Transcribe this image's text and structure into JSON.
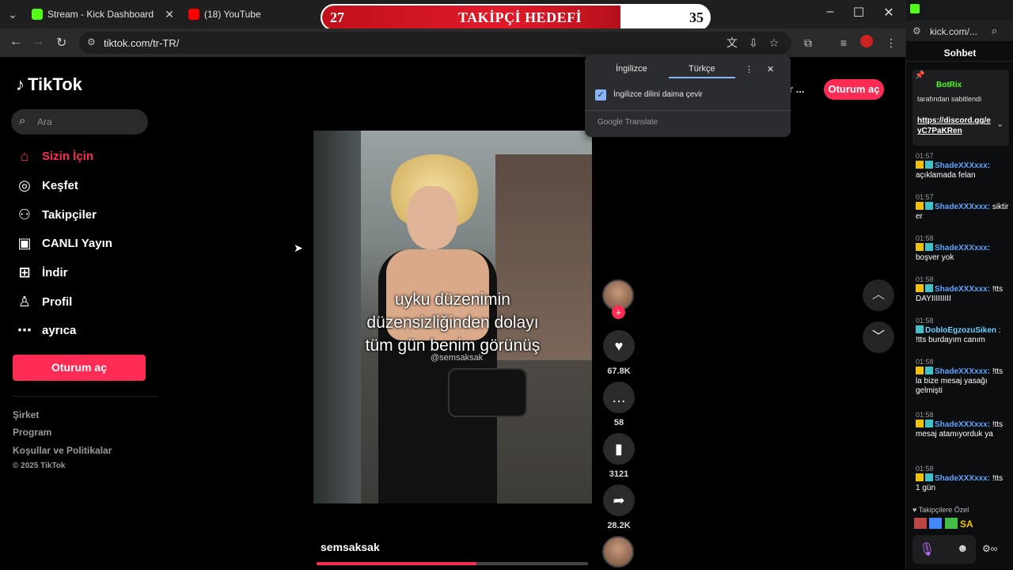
{
  "browser": {
    "tabs": [
      {
        "label": "Stream - Kick Dashboard",
        "color": "#53fc18"
      },
      {
        "label": "(18) YouTube",
        "color": "#ff0000"
      }
    ],
    "url": "tiktok.com/tr-TR/"
  },
  "overlay": {
    "label": "TAKİPÇİ HEDEFİ",
    "current": "27",
    "target": "35",
    "progress": 0.77
  },
  "translate_popup": {
    "lang_source": "İngilizce",
    "lang_target": "Türkçe",
    "option": "İngilizce dilini daima çevir",
    "footer": "Google Translate"
  },
  "tiktok": {
    "logo": "TikTok",
    "search_placeholder": "Ara",
    "nav": [
      {
        "label": "Sizin İçin",
        "icon": "home-icon"
      },
      {
        "label": "Keşfet",
        "icon": "compass-icon"
      },
      {
        "label": "Takipçiler",
        "icon": "followers-icon"
      },
      {
        "label": "CANLI Yayın",
        "icon": "live-icon"
      },
      {
        "label": "İndir",
        "icon": "download-icon"
      },
      {
        "label": "Profil",
        "icon": "profile-icon"
      },
      {
        "label": "ayrıca",
        "icon": "more-icon"
      }
    ],
    "login_label": "Oturum aç",
    "top_partial": "r ...",
    "footer": [
      "Şirket",
      "Program",
      "Koşullar ve Politikalar",
      "© 2025 TikTok"
    ],
    "video": {
      "caption": [
        "uyku düzenimin",
        "düzensizliğinden dolayı",
        "tüm gün benim görünüş"
      ],
      "watermark": "@semsaksak",
      "author": "semsaksak",
      "progress": 0.59
    },
    "actions": [
      {
        "icon": "heart-icon",
        "count": "67.8K"
      },
      {
        "icon": "comment-icon",
        "count": "58"
      },
      {
        "icon": "bookmark-icon",
        "count": "3121"
      },
      {
        "icon": "share-icon",
        "count": "28.2K"
      }
    ]
  },
  "chat": {
    "url": "kick.com/...",
    "title": "Sohbet",
    "pinned": {
      "user": "BotRix",
      "by": "tarafından sabitlendi",
      "link": "https://discord.gg/eyC7PaKRen"
    },
    "messages": [
      {
        "time": "01:57",
        "user": "ShadeXXXxxx:",
        "text": "açıklamada felan"
      },
      {
        "time": "01:57",
        "user": "ShadeXXXxxx:",
        "text": "siktir er"
      },
      {
        "time": "01:58",
        "user": "ShadeXXXxxx:",
        "text": "boşver yok"
      },
      {
        "time": "01:58",
        "user": "ShadeXXXxxx:",
        "text": "!tts DAYIIIIIIIII"
      },
      {
        "time": "01:58",
        "user": "DobloEgzozuSiken",
        "text": ": !tts burdayım canım"
      },
      {
        "time": "01:58",
        "user": "ShadeXXXxxx:",
        "text": "!tts la bize mesaj yasağı gelmişti"
      },
      {
        "time": "01:58",
        "user": "ShadeXXXxxx:",
        "text": "!tts mesaj atamıyorduk ya"
      },
      {
        "time": "01:58",
        "user": "ShadeXXXxxx:",
        "text": "!tts 1 gün"
      }
    ],
    "subscribers_only": "Takipçilere Özel",
    "emotes": "SA"
  }
}
